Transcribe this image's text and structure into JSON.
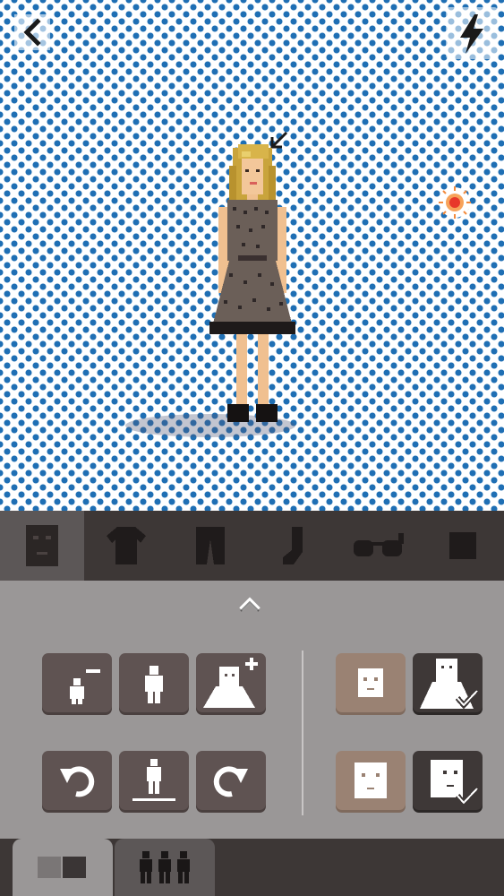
{
  "canvas": {
    "background_pattern": "blue-polka-dot",
    "dot_color": "#1f6fb4",
    "back_icon": "chevron-left-icon",
    "flash_icon": "lightning-bolt-icon",
    "light_icon": "sun-glow-icon",
    "pointer_icon": "arrow-down-left-icon"
  },
  "category_tabs": [
    {
      "name": "face",
      "icon": "face-icon",
      "active": true
    },
    {
      "name": "top",
      "icon": "tshirt-icon",
      "active": false
    },
    {
      "name": "bottom",
      "icon": "pants-icon",
      "active": false
    },
    {
      "name": "socks",
      "icon": "sock-icon",
      "active": false
    },
    {
      "name": "accessories",
      "icon": "glasses-icon",
      "active": false
    },
    {
      "name": "extra",
      "icon": "square-icon",
      "active": false
    }
  ],
  "panel": {
    "collapse_icon": "chevron-up-icon",
    "size_tools": [
      "shrink-figure-icon",
      "standard-figure-icon",
      "grow-figure-icon"
    ],
    "rotate_tools": [
      "rotate-left-icon",
      "figure-on-ground-icon",
      "rotate-right-icon"
    ],
    "right_options": [
      {
        "icon": "small-head-icon",
        "selected": false
      },
      {
        "icon": "head-bust-check-icon",
        "selected": true
      },
      {
        "icon": "face-front-icon",
        "selected": false
      },
      {
        "icon": "face-side-check-icon",
        "selected": true
      }
    ]
  },
  "bottom_tabs": [
    {
      "name": "colors",
      "icon": "color-swatches-icon",
      "active": true
    },
    {
      "name": "people",
      "icon": "three-people-icon",
      "active": false
    }
  ]
}
